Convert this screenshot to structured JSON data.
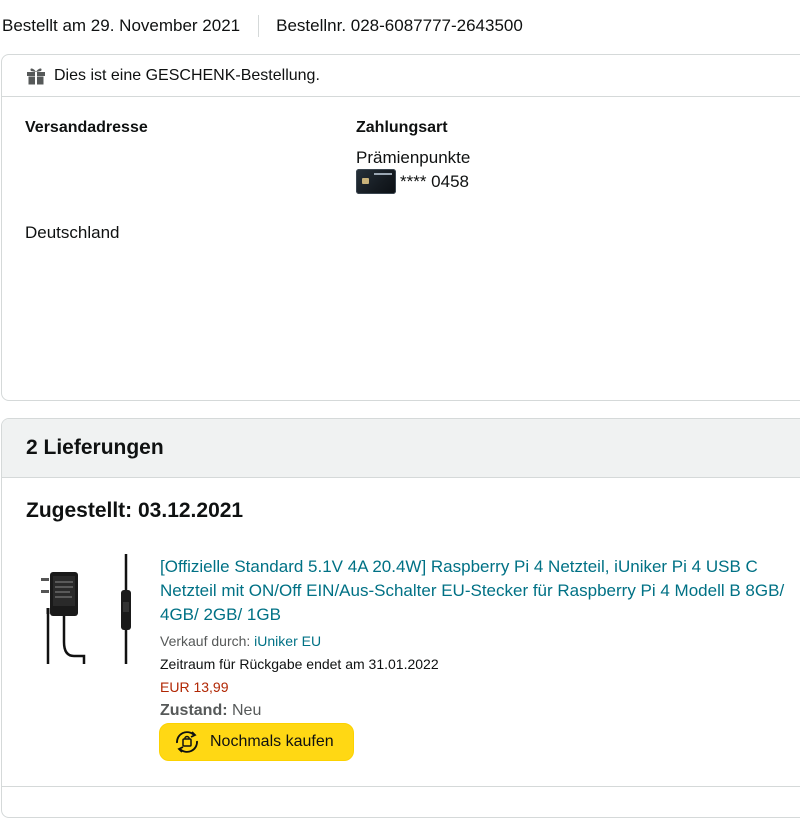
{
  "order": {
    "placed": "Bestellt am 29. November 2021",
    "number": "Bestellnr. 028-6087777-2643500"
  },
  "gift_notice": "Dies ist eine GESCHENK-Bestellung.",
  "shipping": {
    "heading": "Versandadresse",
    "country": "Deutschland"
  },
  "payment": {
    "heading": "Zahlungsart",
    "method": "Prämienpunkte",
    "card_masked": "**** 0458"
  },
  "deliveries": {
    "heading": "2 Lieferungen",
    "items": [
      {
        "status": "Zugestellt: 03.12.2021",
        "title": "[Offizielle Standard 5.1V 4A 20.4W] Raspberry Pi 4 Netzteil, iUniker Pi 4 USB C Netzteil mit ON/Off EIN/Aus-Schalter EU-Stecker für Raspberry Pi 4 Modell B 8GB/ 4GB/ 2GB/ 1GB",
        "seller_label": "Verkauf durch:",
        "seller": "iUniker EU",
        "return_window": "Zeitraum für Rückgabe endet am 31.01.2022",
        "price": "EUR 13,99",
        "condition_label": "Zustand:",
        "condition": "Neu",
        "buy_again": "Nochmals kaufen"
      }
    ]
  },
  "icons": {
    "gift": "gift-icon",
    "card": "credit-card-icon",
    "buy_again": "buy-again-icon"
  },
  "colors": {
    "link": "#007185",
    "price": "#b12704",
    "button": "#ffd814",
    "header_bg": "#f0f2f2",
    "border": "#d5d9d9"
  }
}
